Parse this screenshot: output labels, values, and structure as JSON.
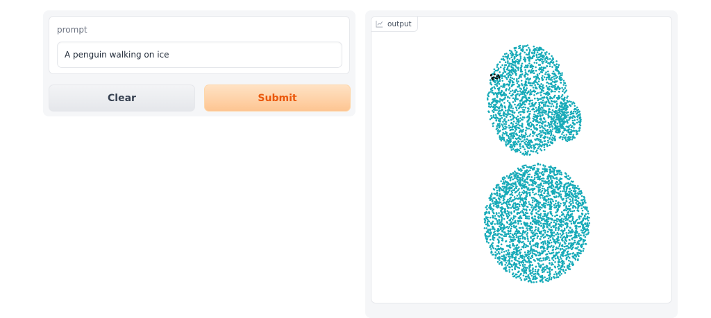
{
  "prompt": {
    "label": "prompt",
    "value": "A penguin walking on ice"
  },
  "buttons": {
    "clear_label": "Clear",
    "submit_label": "Submit"
  },
  "output": {
    "label": "output",
    "icon": "chart-icon",
    "point_color": "#17aab8",
    "eye_color": "#111111"
  }
}
